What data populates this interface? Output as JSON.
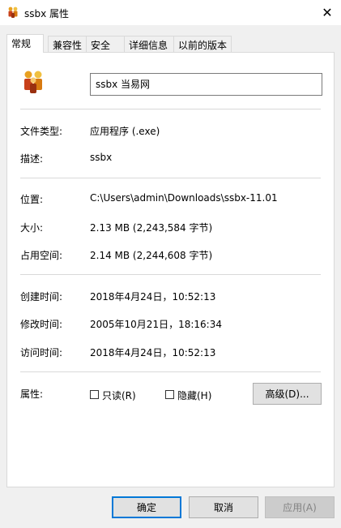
{
  "window": {
    "title": "ssbx 属性",
    "close_symbol": "✕"
  },
  "tabs": [
    {
      "label": "常规",
      "active": true
    },
    {
      "label": "兼容性",
      "active": false
    },
    {
      "label": "安全",
      "active": false
    },
    {
      "label": "详细信息",
      "active": false
    },
    {
      "label": "以前的版本",
      "active": false
    }
  ],
  "general": {
    "icon": "app-people-icon",
    "name_value": "ssbx   当易网",
    "file_type_label": "文件类型:",
    "file_type_value": "应用程序 (.exe)",
    "description_label": "描述:",
    "description_value": "ssbx",
    "location_label": "位置:",
    "location_value": "C:\\Users\\admin\\Downloads\\ssbx-11.01",
    "size_label": "大小:",
    "size_value": "2.13 MB (2,243,584 字节)",
    "disk_size_label": "占用空间:",
    "disk_size_value": "2.14 MB (2,244,608 字节)",
    "created_label": "创建时间:",
    "created_value": "2018年4月24日，10:52:13",
    "modified_label": "修改时间:",
    "modified_value": "2005年10月21日，18:16:34",
    "accessed_label": "访问时间:",
    "accessed_value": "2018年4月24日，10:52:13",
    "attributes_label": "属性:",
    "readonly_label": "只读(R)",
    "readonly_checked": false,
    "hidden_label": "隐藏(H)",
    "hidden_checked": false,
    "advanced_button": "高级(D)..."
  },
  "footer": {
    "ok_label": "确定",
    "cancel_label": "取消",
    "apply_label": "应用(A)"
  },
  "colors": {
    "default_button_border": "#0078d7",
    "panel_background": "#ffffff",
    "window_background": "#f0f0f0"
  }
}
